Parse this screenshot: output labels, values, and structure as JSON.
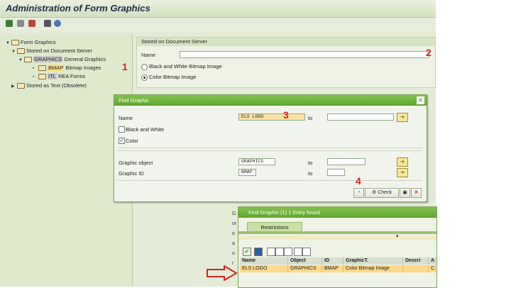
{
  "window": {
    "title": "Administration of Form Graphics"
  },
  "tree": {
    "root": "Form Graphics",
    "stored_on_server": "Stored on Document Server",
    "graphics_key": "GRAPHICS",
    "graphics_desc": "General Graphics",
    "bmap_key": "BMAP",
    "bmap_desc": "Bitmap Images",
    "itl_key": "ITL",
    "itl_desc": "REA Forms",
    "stored_as_text": "Stored as Text (Obsolete)"
  },
  "server_panel": {
    "header": "Stored on Document Server",
    "name_label": "Name",
    "name_value": "",
    "bw_option": "Black and White Bitmap Image",
    "color_option": "Color Bitmap Image",
    "selected": "color"
  },
  "find_dialog": {
    "title": "Find Graphic",
    "name_label": "Name",
    "name_value": "ELS LOGO",
    "to_label": "to",
    "bw_label": "Black and White",
    "color_label": "Color",
    "bw_checked": false,
    "color_checked": true,
    "graphic_object_label": "Graphic object",
    "graphic_object_value": "GRAPHICS",
    "graphic_id_label": "Graphic ID",
    "graphic_id_value": "BMAP",
    "check_label": "Check"
  },
  "results": {
    "title": "Find Graphic (1)   1 Entry found",
    "tab": "Restrictions",
    "columns": [
      "Name",
      "Object",
      "ID",
      "GraphicT.",
      "Descri",
      "A"
    ],
    "rows": [
      [
        "ELS LOGO",
        "GRAPHICS",
        "BMAP",
        "Color Bitmap Image",
        "",
        "C"
      ]
    ]
  },
  "background_fragments": [
    "G",
    "or",
    "o",
    "a",
    "o",
    "r"
  ],
  "annotations": {
    "n1": "1",
    "n2": "2",
    "n3": "3",
    "n4": "4"
  },
  "colors": {
    "accent_green": "#5fa52f",
    "annotation_red": "#d42323",
    "selection_yellow": "#ffd88a"
  }
}
